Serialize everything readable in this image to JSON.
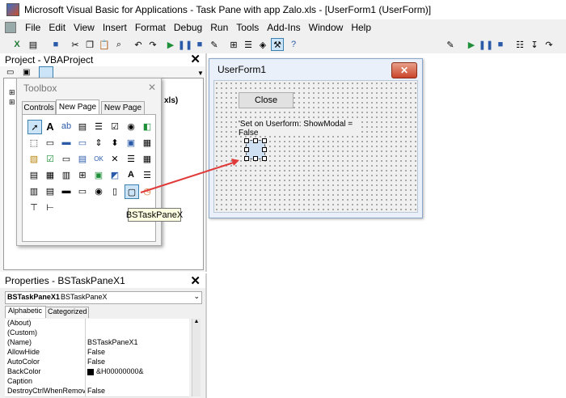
{
  "window": {
    "title": "Microsoft Visual Basic for Applications - Task Pane with app Zalo.xls - [UserForm1 (UserForm)]"
  },
  "menu": [
    "File",
    "Edit",
    "View",
    "Insert",
    "Format",
    "Debug",
    "Run",
    "Tools",
    "Add-Ins",
    "Window",
    "Help"
  ],
  "project": {
    "title": "Project - VBAProject",
    "tree_fragment": "xls)"
  },
  "userform": {
    "title": "UserForm1",
    "close_button": "Close",
    "label_text": "'Set on Userform: ShowModal = False"
  },
  "toolbox": {
    "title": "Toolbox",
    "tabs": [
      "Controls",
      "New Page",
      "New Page"
    ],
    "active_tab": 1
  },
  "tooltip": "BSTaskPaneX",
  "properties": {
    "title": "Properties - BSTaskPaneX1",
    "object_name": "BSTaskPaneX1",
    "object_type": "BSTaskPaneX",
    "tabs": [
      "Alphabetic",
      "Categorized"
    ],
    "rows": [
      {
        "name": "(About)",
        "value": ""
      },
      {
        "name": "(Custom)",
        "value": ""
      },
      {
        "name": "(Name)",
        "value": "BSTaskPaneX1"
      },
      {
        "name": "AllowHide",
        "value": "False"
      },
      {
        "name": "AutoColor",
        "value": "False"
      },
      {
        "name": "BackColor",
        "value": "&H00000000&"
      },
      {
        "name": "Caption",
        "value": ""
      },
      {
        "name": "DestroyCtrlWhenRemove",
        "value": "False"
      }
    ]
  },
  "colors": {
    "selection": "#cce4f7",
    "accent": "#3c7fb1",
    "arrow": "#e03a3a"
  }
}
